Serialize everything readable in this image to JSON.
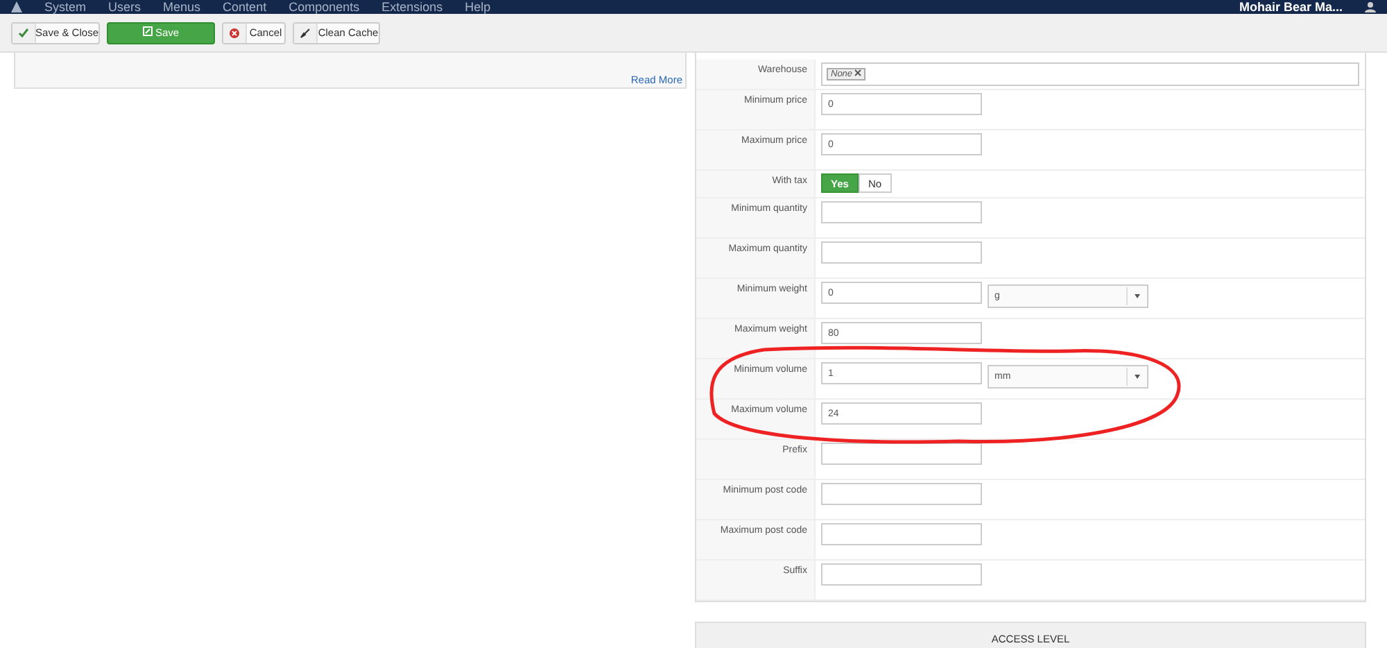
{
  "navbar": {
    "menu": [
      "System",
      "Users",
      "Menus",
      "Content",
      "Components",
      "Extensions",
      "Help"
    ],
    "site_name": "Mohair Bear Ma..."
  },
  "toolbar": [
    {
      "kind": "save-close",
      "label": "Save & Close"
    },
    {
      "kind": "save",
      "label": "Save"
    },
    {
      "kind": "cancel",
      "label": "Cancel"
    },
    {
      "kind": "clean",
      "label": "Clean Cache"
    }
  ],
  "left_panel": {
    "link": "Read More"
  },
  "form": [
    {
      "kind": "tags",
      "label": "Warehouse",
      "tags": [
        "None"
      ]
    },
    {
      "kind": "text",
      "label": "Minimum price",
      "value": "0"
    },
    {
      "kind": "text",
      "label": "Maximum price",
      "value": "0"
    },
    {
      "kind": "toggle",
      "label": "With tax",
      "options": [
        {
          "label": "Yes",
          "selected": true
        },
        {
          "label": "No",
          "selected": false
        }
      ]
    },
    {
      "kind": "text",
      "label": "Minimum quantity"
    },
    {
      "kind": "text",
      "label": "Maximum quantity"
    },
    {
      "kind": "unit",
      "label": "Minimum weight",
      "value": "0",
      "unit": "g"
    },
    {
      "kind": "text",
      "label": "Maximum weight",
      "value": "80"
    },
    {
      "kind": "unit",
      "label": "Minimum volume",
      "value": "1",
      "unit": "mm"
    },
    {
      "kind": "text",
      "label": "Maximum volume",
      "value": "24"
    },
    {
      "kind": "text",
      "label": "Prefix"
    },
    {
      "kind": "text",
      "label": "Minimum post code"
    },
    {
      "kind": "text",
      "label": "Maximum post code"
    },
    {
      "kind": "text",
      "label": "Suffix"
    }
  ],
  "access_panel": {
    "title": "ACCESS LEVEL"
  }
}
